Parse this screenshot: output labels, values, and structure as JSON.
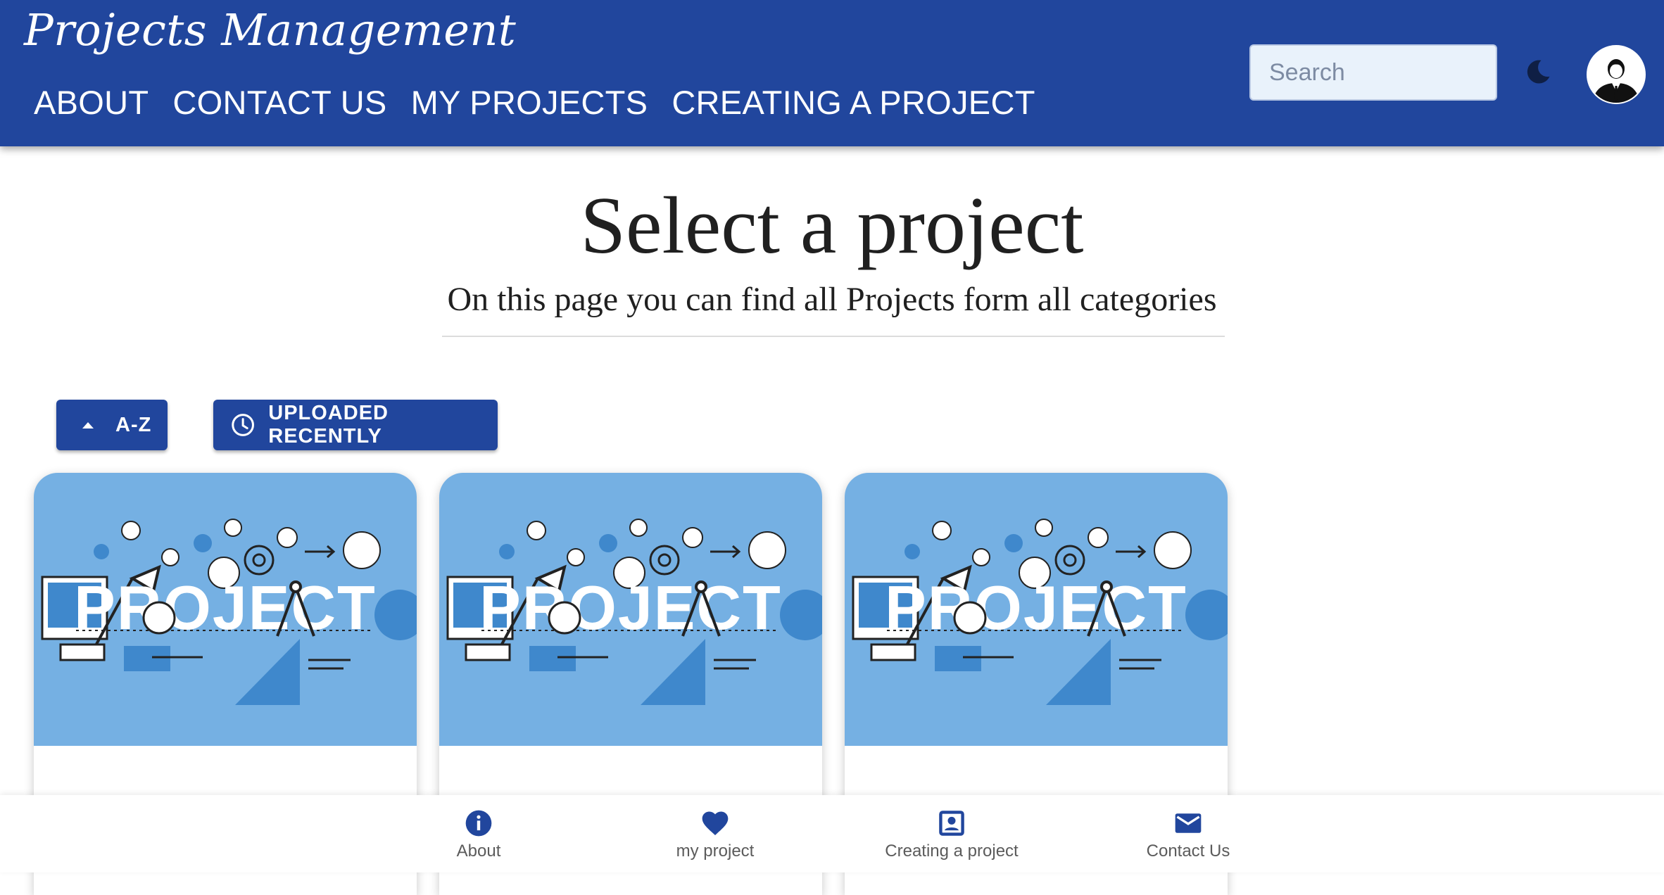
{
  "app": {
    "title": "Projects Management"
  },
  "nav": {
    "items": [
      "ABOUT",
      "CONTACT US",
      "MY PROJECTS",
      "CREATING A PROJECT"
    ]
  },
  "search": {
    "placeholder": "Search",
    "value": ""
  },
  "header_icons": {
    "theme_toggle": "moon-icon",
    "profile": "avatar"
  },
  "page": {
    "title": "Select a project",
    "subtitle": "On this page you can find all Projects form all categories"
  },
  "sort_buttons": {
    "az_label": "A-Z",
    "recent_label": "UPLOADED RECENTLY"
  },
  "cards": [
    {
      "image_text": "PROJECT"
    },
    {
      "image_text": "PROJECT"
    },
    {
      "image_text": "PROJECT"
    }
  ],
  "bottom_nav": {
    "items": [
      {
        "label": "About",
        "icon": "info-icon"
      },
      {
        "label": "my project",
        "icon": "heart-icon"
      },
      {
        "label": "Creating a project",
        "icon": "contact-card-icon"
      },
      {
        "label": "Contact Us",
        "icon": "mail-icon"
      }
    ]
  },
  "colors": {
    "primary": "#21469d",
    "card_image_bg": "#75b0e3",
    "page_bg": "#ffffff"
  }
}
